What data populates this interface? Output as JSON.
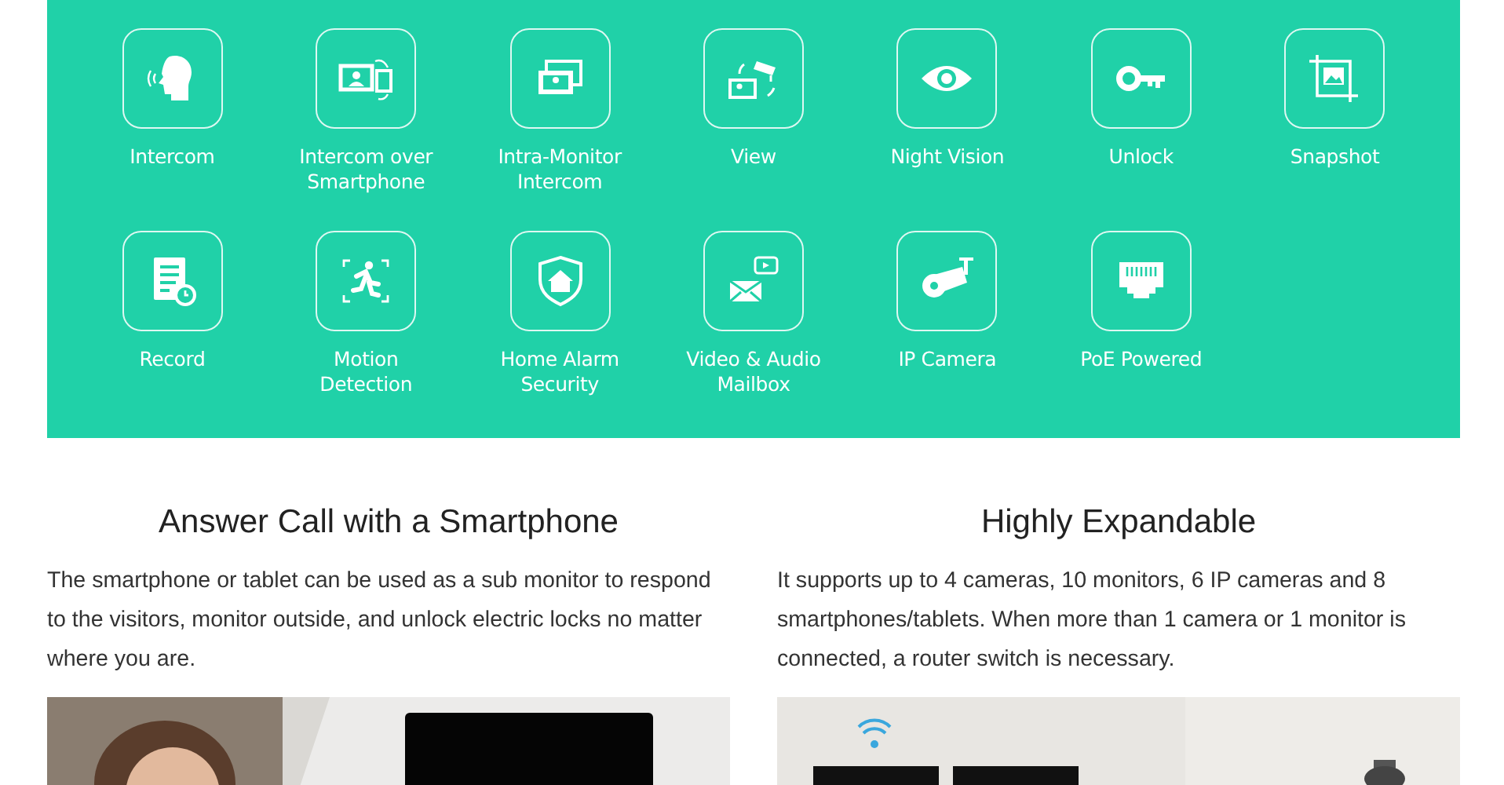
{
  "features": [
    {
      "label": "Intercom"
    },
    {
      "label": "Intercom over Smartphone"
    },
    {
      "label": "Intra-Monitor Intercom"
    },
    {
      "label": "View"
    },
    {
      "label": "Night Vision"
    },
    {
      "label": "Unlock"
    },
    {
      "label": "Snapshot"
    },
    {
      "label": "Record"
    },
    {
      "label": "Motion Detection"
    },
    {
      "label": "Home Alarm Security"
    },
    {
      "label": "Video & Audio Mailbox"
    },
    {
      "label": "IP Camera"
    },
    {
      "label": "PoE Powered"
    }
  ],
  "sections": [
    {
      "title": "Answer Call with a Smartphone",
      "text": "The smartphone or tablet can be used as a sub monitor to respond to the visitors, monitor outside, and unlock electric locks no matter where you are."
    },
    {
      "title": "Highly Expandable",
      "text": "It supports up to 4 cameras, 10 monitors, 6 IP cameras and 8 smartphones/tablets. When more than 1 camera or 1 monitor is connected, a router switch is necessary."
    }
  ]
}
